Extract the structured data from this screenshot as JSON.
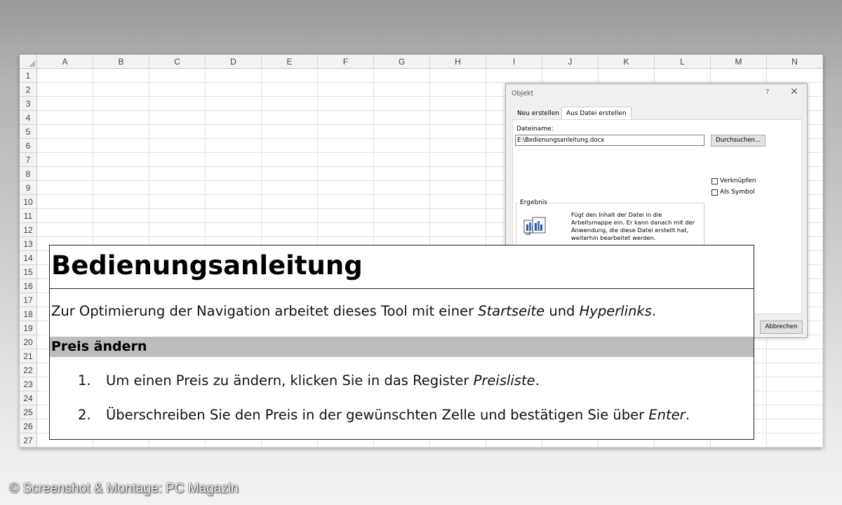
{
  "spreadsheet": {
    "columns": [
      "A",
      "B",
      "C",
      "D",
      "E",
      "F",
      "G",
      "H",
      "I",
      "J",
      "K",
      "L",
      "M",
      "N"
    ],
    "rows": [
      "1",
      "2",
      "3",
      "4",
      "5",
      "6",
      "7",
      "8",
      "9",
      "10",
      "11",
      "12",
      "13",
      "14",
      "15",
      "16",
      "17",
      "18",
      "19",
      "20",
      "21",
      "22",
      "23",
      "24",
      "25",
      "26",
      "27"
    ]
  },
  "dialog": {
    "title": "Objekt",
    "help": "?",
    "close": "✕",
    "tabs": [
      "Neu erstellen",
      "Aus Datei erstellen"
    ],
    "active_tab": "Aus Datei erstellen",
    "filename_label": "Dateiname:",
    "filename_value": "E:\\Bedienungsanleitung.docx",
    "browse_button": "Durchsuchen...",
    "checkbox_link": "Verknüpfen",
    "checkbox_symbol": "Als Symbol",
    "result_label": "Ergebnis",
    "result_text": "Fügt den Inhalt der Datei in die Arbeitsmappe ein. Er kann danach mit der Anwendung, die diese Datei erstellt hat, weiterhin bearbeitet werden.",
    "cancel_button": "Abbrechen"
  },
  "document": {
    "title": "Bedienungsanleitung",
    "intro_prefix": "Zur Optimierung der Navigation arbeitet dieses Tool mit einer ",
    "intro_em1": "Startseite",
    "intro_mid": " und ",
    "intro_em2": "Hyperlinks",
    "intro_suffix": ".",
    "section_heading": "Preis ändern",
    "steps": [
      {
        "num": "1.",
        "text": "Um einen Preis zu ändern, klicken Sie in das Register ",
        "em": "Preisliste",
        "end": "."
      },
      {
        "num": "2.",
        "text": "Überschreiben Sie den Preis in der gewünschten Zelle und bestätigen Sie über ",
        "em": "Enter",
        "end": "."
      }
    ]
  },
  "watermark": "© Screenshot & Montage: PC Magazin"
}
